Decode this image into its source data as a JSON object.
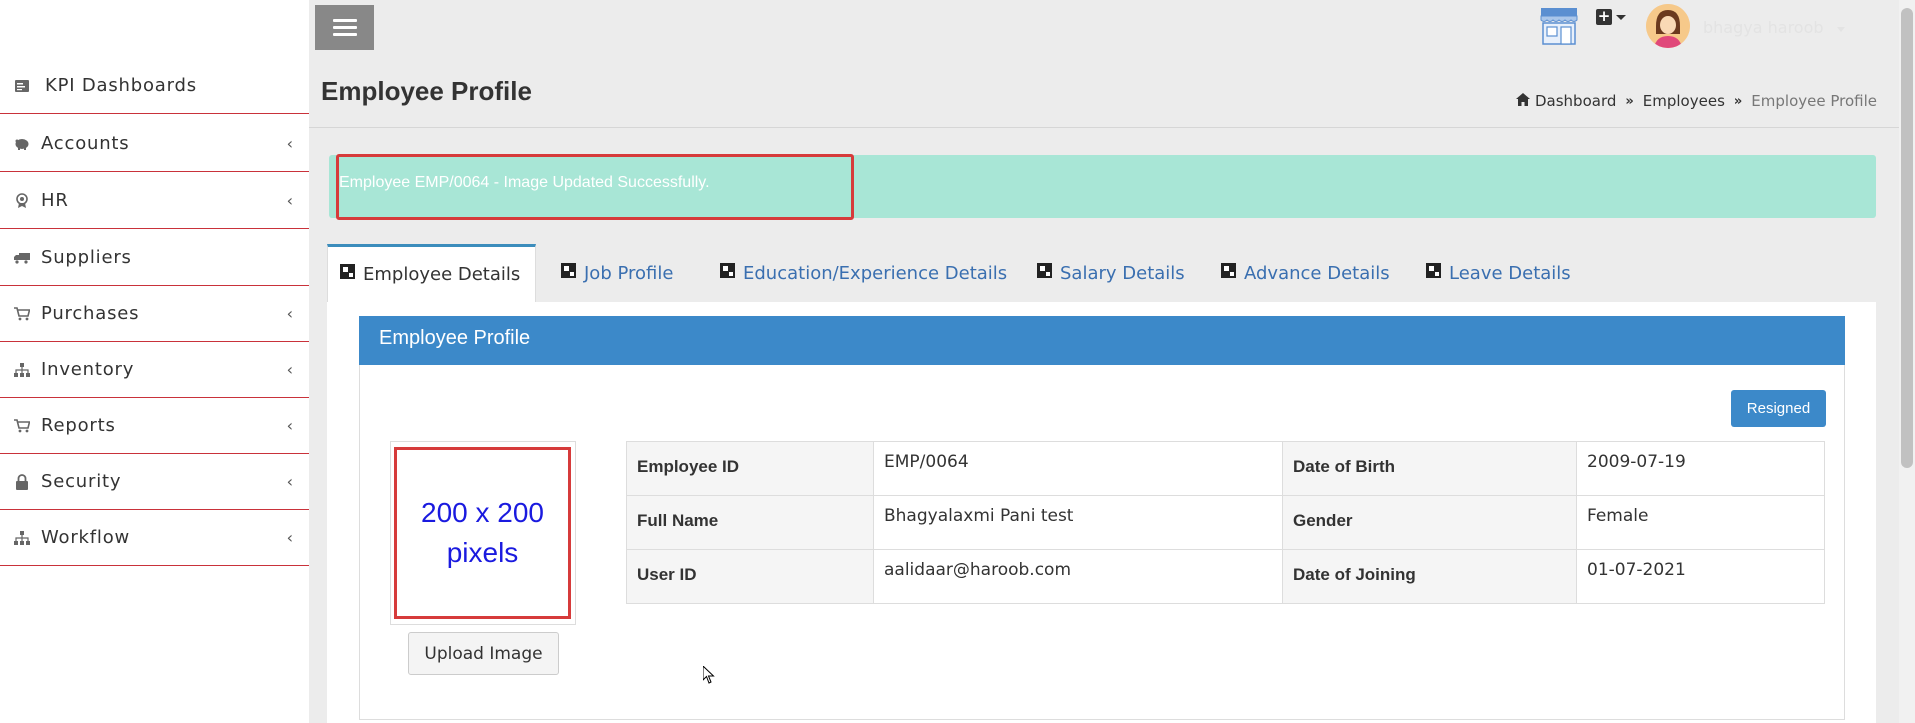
{
  "sidebar": {
    "items": [
      {
        "label": "KPI Dashboards",
        "icon": "dashboard-icon",
        "has_submenu": false
      },
      {
        "label": "Accounts",
        "icon": "piggy-bank-icon",
        "has_submenu": true
      },
      {
        "label": "HR",
        "icon": "badge-icon",
        "has_submenu": true
      },
      {
        "label": "Suppliers",
        "icon": "truck-icon",
        "has_submenu": false
      },
      {
        "label": "Purchases",
        "icon": "cart-icon",
        "has_submenu": true
      },
      {
        "label": "Inventory",
        "icon": "sitemap-icon",
        "has_submenu": true
      },
      {
        "label": "Reports",
        "icon": "cart-icon",
        "has_submenu": true
      },
      {
        "label": "Security",
        "icon": "lock-icon",
        "has_submenu": true
      },
      {
        "label": "Workflow",
        "icon": "sitemap-icon",
        "has_submenu": true
      }
    ]
  },
  "topbar": {
    "user_name": "bhagya haroob"
  },
  "page": {
    "title": "Employee Profile"
  },
  "breadcrumb": {
    "items": [
      "Dashboard",
      "Employees",
      "Employee Profile"
    ]
  },
  "alert": {
    "message": "Employee EMP/0064 - Image Updated Successfully."
  },
  "tabs": [
    {
      "label": "Employee Details",
      "active": true
    },
    {
      "label": "Job Profile",
      "active": false
    },
    {
      "label": "Education/Experience Details",
      "active": false
    },
    {
      "label": "Salary Details",
      "active": false
    },
    {
      "label": "Advance Details",
      "active": false
    },
    {
      "label": "Leave Details",
      "active": false
    }
  ],
  "profile": {
    "box_title": "Employee Profile",
    "status_badge": "Resigned",
    "image_placeholder_line1": "200 x 200",
    "image_placeholder_line2": "pixels",
    "upload_label": "Upload Image",
    "fields": {
      "employee_id_label": "Employee ID",
      "employee_id": "EMP/0064",
      "dob_label": "Date of Birth",
      "dob": "2009-07-19",
      "full_name_label": "Full Name",
      "full_name": "Bhagyalaxmi Pani test",
      "gender_label": "Gender",
      "gender": "Female",
      "user_id_label": "User ID",
      "user_id": "aalidaar@haroob.com",
      "doj_label": "Date of Joining",
      "doj": "01-07-2021"
    }
  },
  "colors": {
    "accent": "#3c89c9",
    "alert_bg": "#a8e6d6",
    "highlight": "#d63b3b",
    "sidebar_divider": "#c9323a"
  }
}
